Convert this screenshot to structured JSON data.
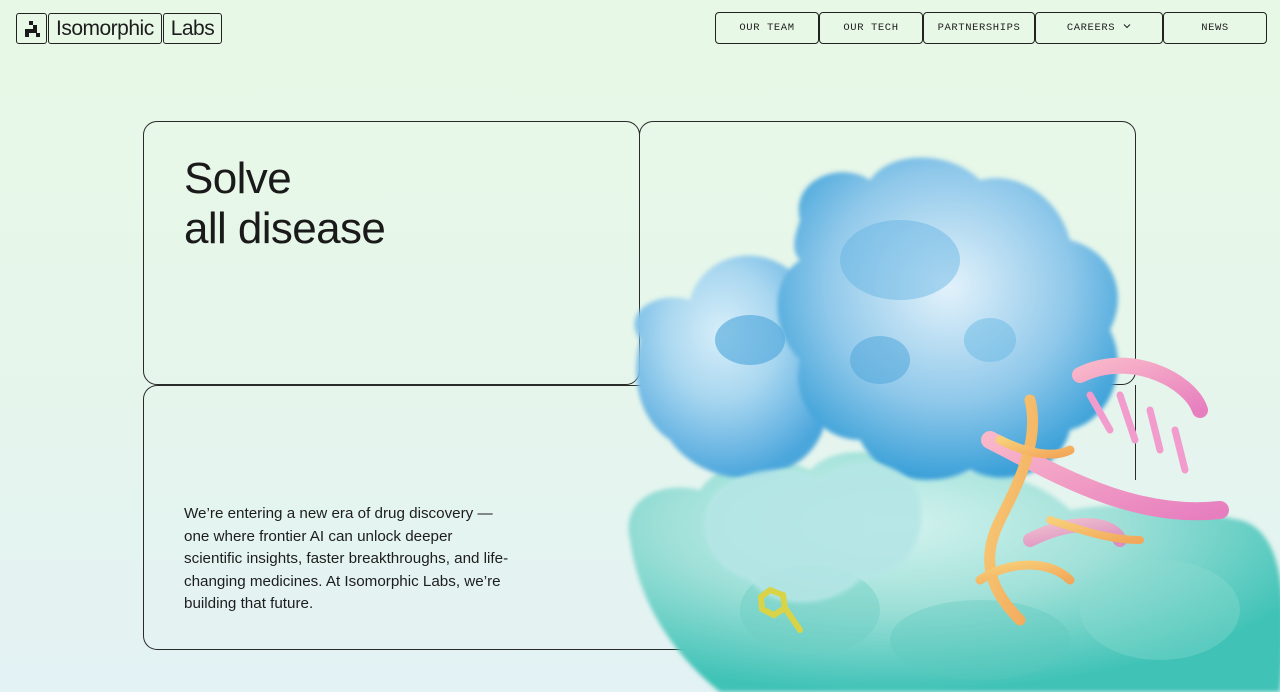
{
  "brand": {
    "name_part1": "Isomorphic",
    "name_part2": "Labs",
    "mark_icon": "isomorphic-pixel-logo-icon"
  },
  "nav": {
    "items": [
      {
        "label": "OUR TEAM"
      },
      {
        "label": "OUR TECH"
      },
      {
        "label": "PARTNERSHIPS"
      },
      {
        "label": "CAREERS",
        "has_dropdown": true,
        "icon": "chevron-down-icon"
      },
      {
        "label": "NEWS"
      }
    ]
  },
  "hero": {
    "headline_line1": "Solve",
    "headline_line2": "all disease",
    "intro": "We’re entering a new era of drug discovery — one where frontier AI can unlock deeper scientific insights, faster breakthroughs, and life-changing medicines. At Isomorphic Labs, we’re building that future.",
    "image": "protein-dna-molecule-render"
  },
  "colors": {
    "background_top": "#e8f8e6",
    "background_bottom": "#e3f2f4",
    "border": "#222222",
    "protein_blue": "#7fc6e6",
    "protein_teal": "#74d3c8",
    "dna_pink": "#ef8fc1",
    "dna_orange": "#f6b45a",
    "ligand_yellow": "#d9d348"
  }
}
